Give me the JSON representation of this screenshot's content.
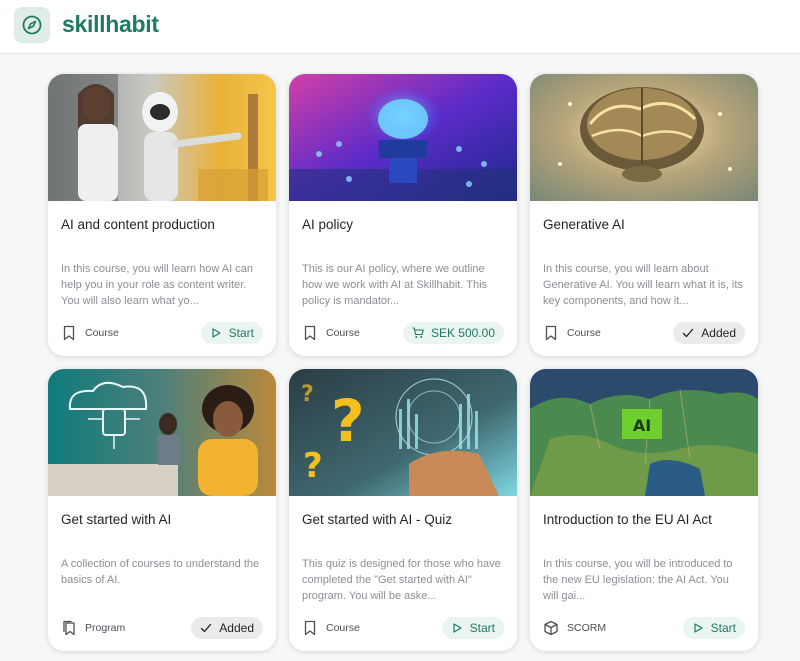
{
  "header": {
    "brand": "skillhabit",
    "logo_icon": "compass-icon"
  },
  "colors": {
    "accent": "#1e7a64",
    "start_bg": "#eaf4f1",
    "added_bg": "#ebebeb"
  },
  "cards": [
    {
      "title": "AI and content production",
      "description": "In this course, you will learn how AI can help you in your role as content writer. You will also learn what yo...",
      "type": "Course",
      "type_icon": "bookmark-icon",
      "action": "Start",
      "action_icon": "play-icon"
    },
    {
      "title": "AI policy",
      "description": "This is our AI policy, where we outline how we work with AI at Skillhabit. This policy is mandator...",
      "type": "Course",
      "type_icon": "bookmark-icon",
      "action": "SEK 500.00",
      "action_icon": "cart-icon"
    },
    {
      "title": "Generative AI",
      "description": "In this course, you will learn about Generative AI. You will learn what it is, its key components, and how it...",
      "type": "Course",
      "type_icon": "bookmark-icon",
      "action": "Added",
      "action_icon": "check-icon"
    },
    {
      "title": "Get started with AI",
      "description": "A collection of courses to understand the basics of AI.",
      "type": "Program",
      "type_icon": "stacked-bookmark-icon",
      "action": "Added",
      "action_icon": "check-icon"
    },
    {
      "title": "Get started with AI - Quiz",
      "description": "This quiz is designed for those who have completed the \"Get started with AI\" program. You will be aske...",
      "type": "Course",
      "type_icon": "bookmark-icon",
      "action": "Start",
      "action_icon": "play-icon"
    },
    {
      "title": "Introduction to the EU AI Act",
      "description": "In this course, you will be introduced to the new EU legislation: the AI Act. You will gai...",
      "type": "SCORM",
      "type_icon": "cube-icon",
      "action": "Start",
      "action_icon": "play-icon"
    }
  ]
}
